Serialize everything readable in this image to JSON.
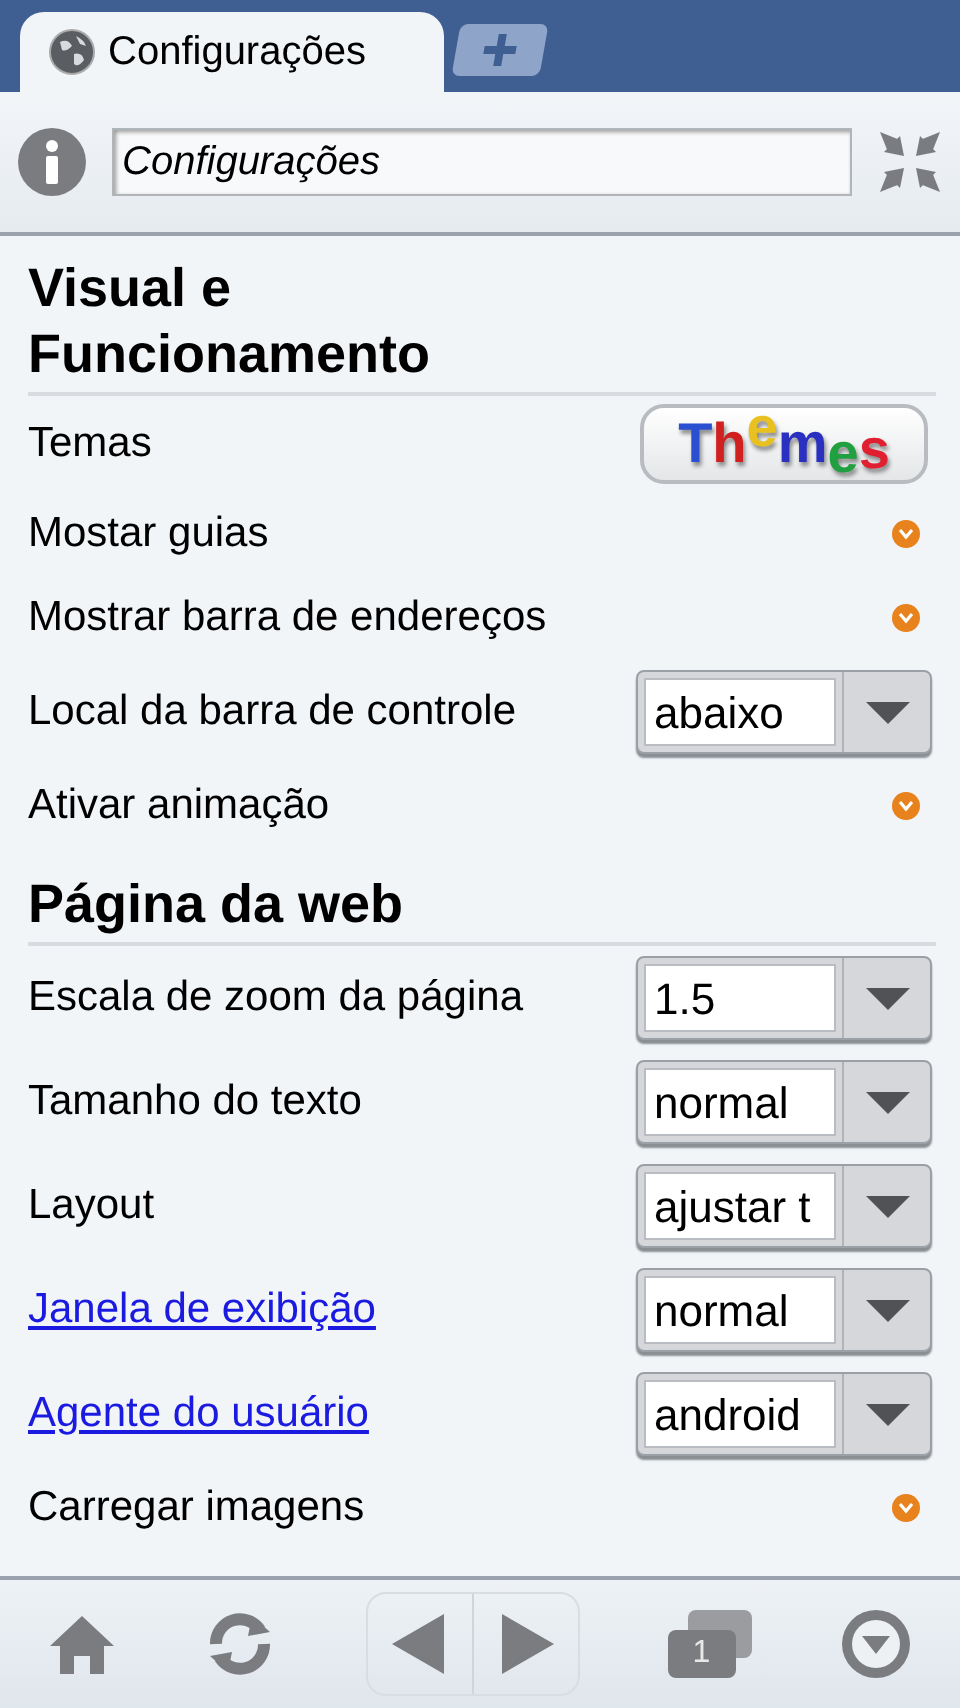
{
  "tabs": [
    {
      "label": "Configurações",
      "selected": true
    }
  ],
  "address_bar": {
    "value": "Configurações"
  },
  "sections": [
    {
      "title": "Visual e Funcionamento",
      "rows": [
        {
          "kind": "image",
          "label": "Temas",
          "badge": [
            "T",
            "h",
            "e",
            "m",
            "e",
            "s"
          ]
        },
        {
          "kind": "checkbox",
          "label": "Mostar guias",
          "checked": true
        },
        {
          "kind": "checkbox",
          "label": "Mostrar barra de endereços",
          "checked": true
        },
        {
          "kind": "select",
          "label": "Local da barra de controle",
          "value": "abaixo"
        },
        {
          "kind": "checkbox",
          "label": "Ativar animação",
          "checked": true
        }
      ]
    },
    {
      "title": "Página da web",
      "rows": [
        {
          "kind": "select",
          "label": "Escala de zoom da página",
          "value": "1.5"
        },
        {
          "kind": "select",
          "label": "Tamanho do texto",
          "value": "normal"
        },
        {
          "kind": "select",
          "label": "Layout",
          "value": "ajustar t"
        },
        {
          "kind": "select",
          "label": "Janela de exibição",
          "value": "normal",
          "link": true
        },
        {
          "kind": "select",
          "label": "Agente do usuário",
          "value": "android",
          "link": true
        },
        {
          "kind": "checkbox",
          "label": "Carregar imagens",
          "checked": true
        }
      ]
    }
  ],
  "toolbar": {
    "tab_count": "1"
  }
}
